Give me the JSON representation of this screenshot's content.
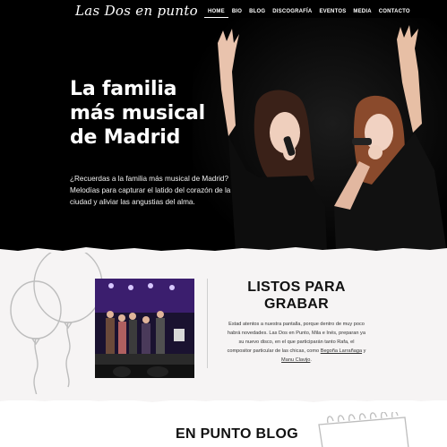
{
  "header": {
    "logo": "Las Dos en punto",
    "nav": [
      {
        "label": "HOME",
        "active": true
      },
      {
        "label": "BIO",
        "active": false
      },
      {
        "label": "BLOG",
        "active": false
      },
      {
        "label": "DISCOGRAFÍA",
        "active": false
      },
      {
        "label": "EVENTOS",
        "active": false
      },
      {
        "label": "MEDIA",
        "active": false
      },
      {
        "label": "CONTACTO",
        "active": false
      }
    ]
  },
  "hero": {
    "title_lines": [
      "La familia",
      "más musical",
      "de Madrid"
    ],
    "text": "¿Recuerdas a la familia más musical de Madrid? Melodías para capturar el latido del corazón de la ciudad y aliviar las angustias del alma."
  },
  "feature": {
    "title_lines": [
      "LISTOS PARA",
      "GRABAR"
    ],
    "text_before": "Estad atentos a nuestra pantalla, porque dentro de muy poco habrá novedades. Las Dos en Punto, Mila e Inés, preparan ya su nuevo disco, en el que participarán tanto Rafa, el compositor particular de las chicas, como ",
    "link1": "Begoña Larrañaga",
    "text_between": " y ",
    "link2": "Manu Clavijo",
    "text_after": "."
  },
  "blog": {
    "title": "EN PUNTO BLOG"
  },
  "colors": {
    "hero_bg": "#000000",
    "feature_bg": "#f6f4f4",
    "text_dark": "#111111"
  }
}
